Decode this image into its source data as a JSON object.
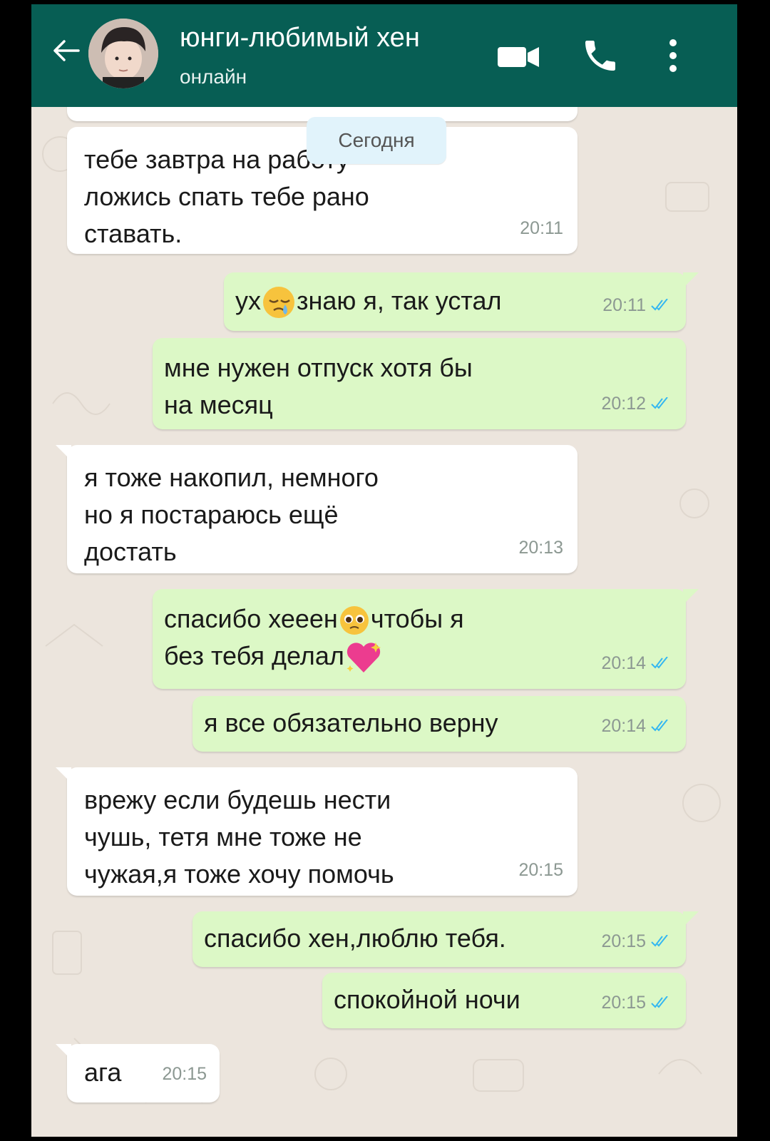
{
  "header": {
    "contact_name": "юнги-любимый хен",
    "status": "онлайн",
    "colors": {
      "bar": "#075e54",
      "outgoing": "#dcf8c6",
      "incoming": "#ffffff",
      "ticks": "#34b7f1"
    }
  },
  "day_label": "Сегодня",
  "messages": [
    {
      "dir": "in",
      "text": "тебе завтра на работу\nложись спать тебе  рано\nставать.",
      "time": "20:11"
    },
    {
      "dir": "out",
      "text": "ух знаю я, так устал",
      "time": "20:11",
      "emoji": "sleepy-face"
    },
    {
      "dir": "out",
      "text": "мне нужен отпуск хотя бы\nна месяц",
      "time": "20:12"
    },
    {
      "dir": "in",
      "text": "я тоже накопил, немного\nно я постараюсь ещё\nдостать",
      "time": "20:13"
    },
    {
      "dir": "out",
      "text": "спасибо хееен чтобы я\nбез тебя делал",
      "time": "20:14",
      "emoji": [
        "pleading-face",
        "sparkling-heart"
      ]
    },
    {
      "dir": "out",
      "text": "я все обязательно верну",
      "time": "20:14"
    },
    {
      "dir": "in",
      "text": "врежу если будешь нести\nчушь, тетя мне тоже не\nчужая,я тоже хочу помочь",
      "time": "20:15"
    },
    {
      "dir": "out",
      "text": "спасибо хен,люблю тебя.",
      "time": "20:15"
    },
    {
      "dir": "out",
      "text": "спокойной ночи",
      "time": "20:15"
    },
    {
      "dir": "in",
      "text": "ага",
      "time": "20:15"
    }
  ]
}
